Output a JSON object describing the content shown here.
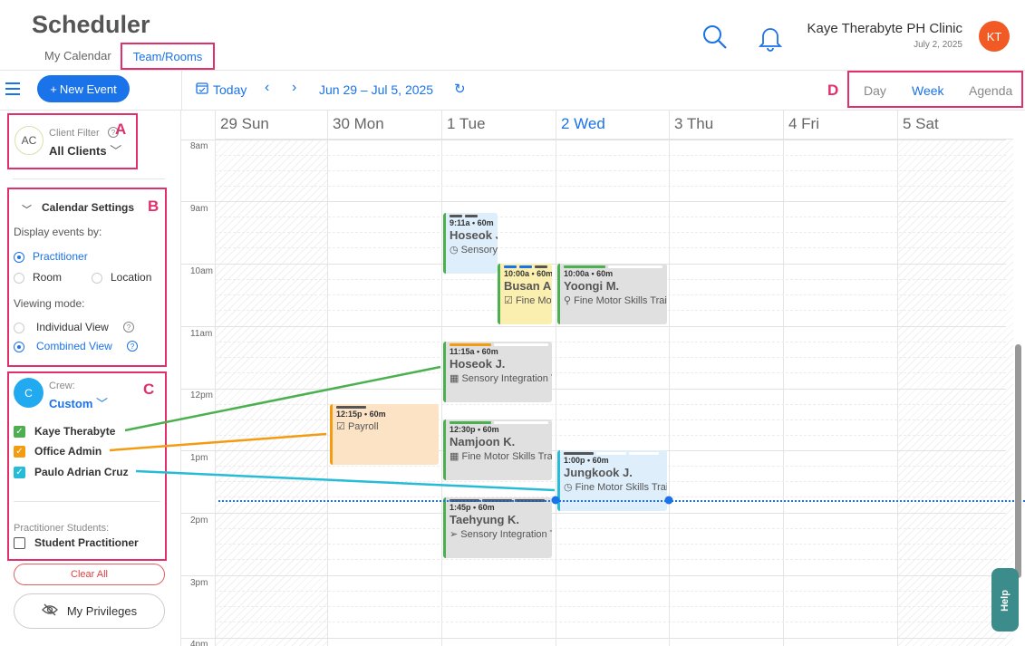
{
  "header": {
    "title": "Scheduler",
    "tabs": [
      "My Calendar",
      "Team/Rooms"
    ],
    "clinic_name": "Kaye Therabyte PH Clinic",
    "date": "July 2, 2025",
    "avatar_initials": "KT",
    "icons": [
      "search-icon",
      "bell-icon"
    ]
  },
  "toolbar": {
    "new_event": "New Event",
    "today": "Today",
    "range": "Jun 29 – Jul 5, 2025",
    "views": [
      "Day",
      "Week",
      "Agenda"
    ],
    "active_view": "Week"
  },
  "markers": [
    "A",
    "B",
    "C",
    "D"
  ],
  "sidebar": {
    "client_filter": {
      "avatar": "AC",
      "label": "Client Filter",
      "value": "All Clients"
    },
    "settings": {
      "title": "Calendar Settings",
      "display_label": "Display events by:",
      "display_options": [
        "Practitioner",
        "Room",
        "Location"
      ],
      "display_selected": "Practitioner",
      "viewing_label": "Viewing mode:",
      "viewing_options": [
        "Individual View",
        "Combined View"
      ],
      "viewing_selected": "Combined View"
    },
    "crew": {
      "avatar": "C",
      "label": "Crew:",
      "value": "Custom",
      "members": [
        {
          "name": "Kaye Therabyte",
          "checked": true,
          "color": "#4caf50"
        },
        {
          "name": "Office Admin",
          "checked": true,
          "color": "#f39c12"
        },
        {
          "name": "Paulo Adrian Cruz",
          "checked": true,
          "color": "#26bcd7"
        }
      ],
      "students_label": "Practitioner Students:",
      "students": [
        {
          "name": "Student Practitioner",
          "checked": false
        }
      ]
    },
    "clear_all": "Clear All",
    "privileges": "My Privileges"
  },
  "calendar": {
    "days": [
      "29 Sun",
      "30 Mon",
      "1 Tue",
      "2 Wed",
      "3 Thu",
      "4 Fri",
      "5 Sat"
    ],
    "today_index": 3,
    "hours": [
      "8am",
      "9am",
      "10am",
      "11am",
      "12pm",
      "1pm",
      "2pm",
      "3pm",
      "4pm"
    ],
    "events": [
      {
        "time": "9:11a • 60m",
        "name": "Hoseok J.",
        "service": "Sensory Integration",
        "icon": "clock-icon",
        "bg": "#deeefb",
        "border": "#4caf50",
        "bars": [
          "#555",
          "#555"
        ]
      },
      {
        "time": "10:00a • 60m",
        "name": "Busan Ar",
        "service": "Fine Motor Skills",
        "icon": "checkbox-icon",
        "bg": "#fbefb0",
        "border": "#4caf50",
        "bars": [
          "#1a73e8",
          "#1a73e8",
          "#555"
        ]
      },
      {
        "time": "10:00a • 60m",
        "name": "Yoongi M.",
        "service": "Fine Motor Skills Training",
        "icon": "link-icon",
        "bg": "#e0e0e0",
        "border": "#4caf50",
        "bars": [
          "#4caf50",
          "#fff"
        ]
      },
      {
        "time": "11:15a • 60m",
        "name": "Hoseok J.",
        "service": "Sensory Integration Therapy",
        "icon": "calendar-icon",
        "bg": "#e0e0e0",
        "border": "#4caf50",
        "bars": [
          "#f39c12",
          "#fff"
        ]
      },
      {
        "time": "12:15p • 60m",
        "name": "",
        "service": "Payroll",
        "icon": "checkbox-icon",
        "bg": "#fde3c5",
        "border": "#f39c12",
        "bars": [
          "#555"
        ]
      },
      {
        "time": "12:30p • 60m",
        "name": "Namjoon K.",
        "service": "Fine Motor Skills Training",
        "icon": "calendar-icon",
        "bg": "#e0e0e0",
        "border": "#4caf50",
        "bars": [
          "#4caf50",
          "#fff"
        ]
      },
      {
        "time": "1:00p • 60m",
        "name": "Jungkook J.",
        "service": "Fine Motor Skills Training",
        "icon": "clock-icon",
        "bg": "#deeefb",
        "border": "#26bcd7",
        "bars": [
          "#555",
          "#fff",
          "#fff"
        ]
      },
      {
        "time": "1:45p • 60m",
        "name": "Taehyung K.",
        "service": "Sensory Integration Therapy",
        "icon": "send-icon",
        "bg": "#e0e0e0",
        "border": "#4caf50",
        "bars": [
          "#555",
          "#555",
          "#555"
        ]
      }
    ]
  },
  "help": "Help"
}
